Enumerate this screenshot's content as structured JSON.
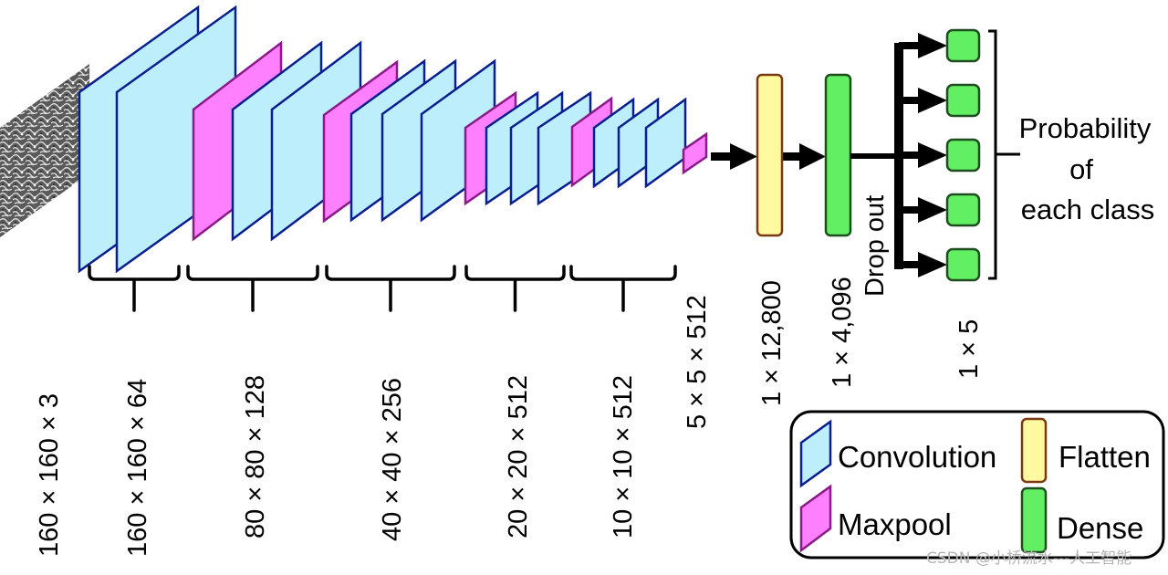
{
  "colors": {
    "conv_fill": "#bdeefc",
    "conv_stroke": "#0a1f8f",
    "pool_fill": "#ff80ff",
    "pool_stroke": "#8a1a8a",
    "flatten_fill": "#fff9a0",
    "flatten_stroke": "#7a3a10",
    "dense_fill": "#63ef63",
    "dense_stroke": "#1e4d1e",
    "arrow": "#000000",
    "text": "#000000",
    "watermark": "#b0b0b0"
  },
  "input": {
    "label": "input image",
    "shape_label": "160 × 160 × 3"
  },
  "feature_map_layers": [
    {
      "type": "conv"
    },
    {
      "type": "conv"
    },
    {
      "type": "pool"
    },
    {
      "type": "conv"
    },
    {
      "type": "conv"
    },
    {
      "type": "pool"
    },
    {
      "type": "conv"
    },
    {
      "type": "conv"
    },
    {
      "type": "conv"
    },
    {
      "type": "pool"
    },
    {
      "type": "conv"
    },
    {
      "type": "conv"
    },
    {
      "type": "conv"
    },
    {
      "type": "pool"
    },
    {
      "type": "conv"
    },
    {
      "type": "conv"
    },
    {
      "type": "conv"
    },
    {
      "type": "pool"
    }
  ],
  "block_labels": [
    "160 × 160 × 64",
    "80 × 80 × 128",
    "40 × 40 × 256",
    "20 × 20 × 512",
    "10 × 10 × 512"
  ],
  "final_pool_label": "5 × 5 × 512",
  "flatten": {
    "label": "1 × 12,800"
  },
  "dense": {
    "label": "1 × 4,096",
    "dropout_label": "Drop out"
  },
  "output": {
    "label": "1 × 5",
    "node_count": 5,
    "description_lines": [
      "Probability",
      "of",
      "each class"
    ]
  },
  "legend": {
    "items": [
      {
        "key": "conv",
        "label": "Convolution"
      },
      {
        "key": "pool",
        "label": "Maxpool"
      },
      {
        "key": "flatten",
        "label": "Flatten"
      },
      {
        "key": "dense",
        "label": "Dense"
      }
    ]
  },
  "watermark": "CSDN @小桥流水---人工智能"
}
